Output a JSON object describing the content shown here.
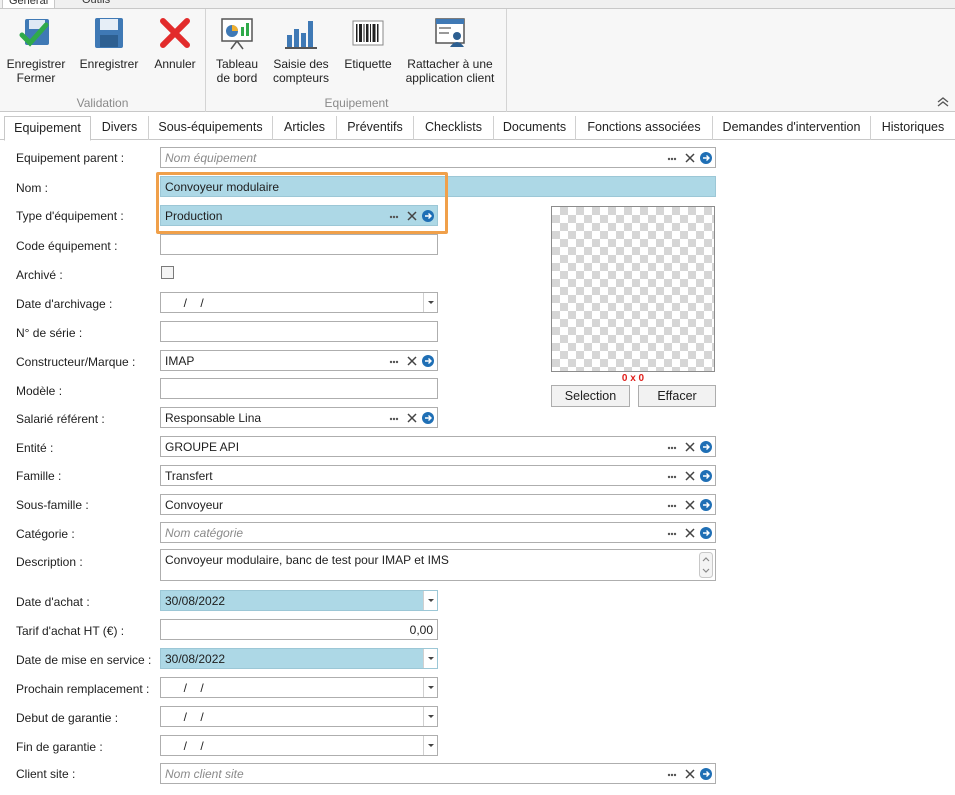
{
  "ribbon": {
    "tabs": [
      "Général",
      "Outils"
    ],
    "groups": [
      {
        "label": "Validation",
        "buttons": [
          {
            "line1": "Enregistrer",
            "line2": "Fermer"
          },
          {
            "line1": "Enregistrer",
            "line2": ""
          },
          {
            "line1": "Annuler",
            "line2": ""
          }
        ]
      },
      {
        "label": "Equipement",
        "buttons": [
          {
            "line1": "Tableau",
            "line2": "de bord"
          },
          {
            "line1": "Saisie des",
            "line2": "compteurs"
          },
          {
            "line1": "Etiquette",
            "line2": ""
          },
          {
            "line1": "Rattacher à une",
            "line2": "application client"
          }
        ]
      }
    ]
  },
  "tabs": [
    "Equipement",
    "Divers",
    "Sous-équipements",
    "Articles",
    "Préventifs",
    "Checklists",
    "Documents",
    "Fonctions associées",
    "Demandes d'intervention",
    "Historiques"
  ],
  "form": {
    "equipement_parent": {
      "label": "Equipement parent :",
      "placeholder": "Nom équipement"
    },
    "nom": {
      "label": "Nom :",
      "value": "Convoyeur modulaire"
    },
    "type": {
      "label": "Type d'équipement :",
      "value": "Production"
    },
    "code": {
      "label": "Code équipement :",
      "value": ""
    },
    "archive": {
      "label": "Archivé :"
    },
    "date_archivage": {
      "label": "Date d'archivage :",
      "value": "  /    /"
    },
    "serie": {
      "label": "N° de série :",
      "value": ""
    },
    "constructeur": {
      "label": "Constructeur/Marque :",
      "value": "IMAP"
    },
    "modele": {
      "label": "Modèle :",
      "value": ""
    },
    "salarie": {
      "label": "Salarié référent :",
      "value": "Responsable Lina"
    },
    "entite": {
      "label": "Entité :",
      "value": "GROUPE API"
    },
    "famille": {
      "label": "Famille :",
      "value": "Transfert"
    },
    "sous_famille": {
      "label": "Sous-famille :",
      "value": "Convoyeur"
    },
    "categorie": {
      "label": "Catégorie :",
      "placeholder": "Nom catégorie"
    },
    "description": {
      "label": "Description :",
      "value": "Convoyeur modulaire, banc de test pour IMAP et IMS"
    },
    "date_achat": {
      "label": "Date d'achat :",
      "value": "30/08/2022"
    },
    "tarif": {
      "label": "Tarif d'achat HT (€) :",
      "value": "0,00"
    },
    "mise_service": {
      "label": "Date de mise en service :",
      "value": "30/08/2022"
    },
    "remplacement": {
      "label": "Prochain remplacement :",
      "value": "  /    /"
    },
    "debut_garantie": {
      "label": "Debut de garantie :",
      "value": "  /    /"
    },
    "fin_garantie": {
      "label": "Fin de garantie :",
      "value": "  /    /"
    },
    "client_site": {
      "label": "Client site :",
      "placeholder": "Nom client site"
    }
  },
  "photo": {
    "dims": "0 x 0",
    "select_label": "Selection",
    "clear_label": "Effacer"
  },
  "colors": {
    "highlight": "#f0a04a",
    "field_blue": "#add8e6",
    "accent": "#1f6fb5"
  }
}
